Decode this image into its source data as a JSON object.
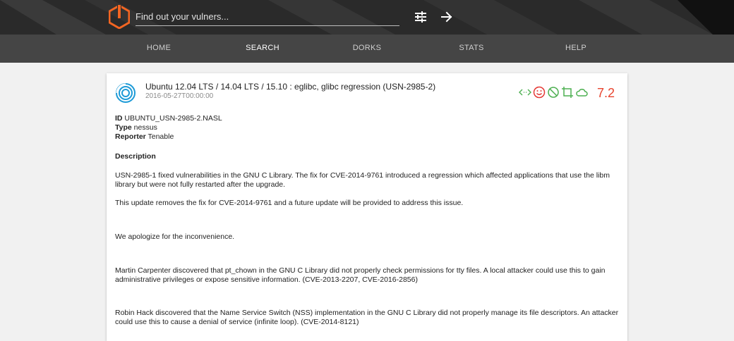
{
  "search": {
    "placeholder": "Find out your vulners..."
  },
  "nav": {
    "items": [
      {
        "label": "HOME",
        "active": false
      },
      {
        "label": "SEARCH",
        "active": true
      },
      {
        "label": "DORKS",
        "active": false
      },
      {
        "label": "STATS",
        "active": false
      },
      {
        "label": "HELP",
        "active": false
      }
    ]
  },
  "colors": {
    "brand_orange": "#f26522",
    "score_red": "#e8442e",
    "badge_green": "#4caf50",
    "badge_red": "#e53935"
  },
  "icons": {
    "filter": "tune-icon",
    "go": "arrow-right-icon",
    "badges": [
      "network-vector-icon",
      "smiley-icon",
      "block-icon",
      "crop-icon",
      "cloud-icon"
    ]
  },
  "result": {
    "title": "Ubuntu 12.04 LTS / 14.04 LTS / 15.10 : eglibc, glibc regression (USN-2985-2)",
    "date": "2016-05-27T00:00:00",
    "score": "7.2",
    "meta": {
      "id_label": "ID",
      "id_value": "UBUNTU_USN-2985-2.NASL",
      "type_label": "Type",
      "type_value": "nessus",
      "reporter_label": "Reporter",
      "reporter_value": "Tenable"
    },
    "description_label": "Description",
    "paragraphs": [
      "USN-2985-1 fixed vulnerabilities in the GNU C Library. The fix for CVE-2014-9761 introduced a regression which affected applications that use the libm library but were not fully restarted after the upgrade.",
      "This update removes the fix for CVE-2014-9761 and a future update will be provided to address this issue.",
      "We apologize for the inconvenience.",
      "Martin Carpenter discovered that pt_chown in the GNU C Library did not properly check permissions for tty files. A local attacker could use this to gain administrative privileges or expose sensitive information. (CVE-2013-2207, CVE-2016-2856)",
      "Robin Hack discovered that the Name Service Switch (NSS) implementation in the GNU C Library did not properly manage its file descriptors. An attacker could use this to cause a denial of service (infinite loop). (CVE-2014-8121)"
    ]
  }
}
